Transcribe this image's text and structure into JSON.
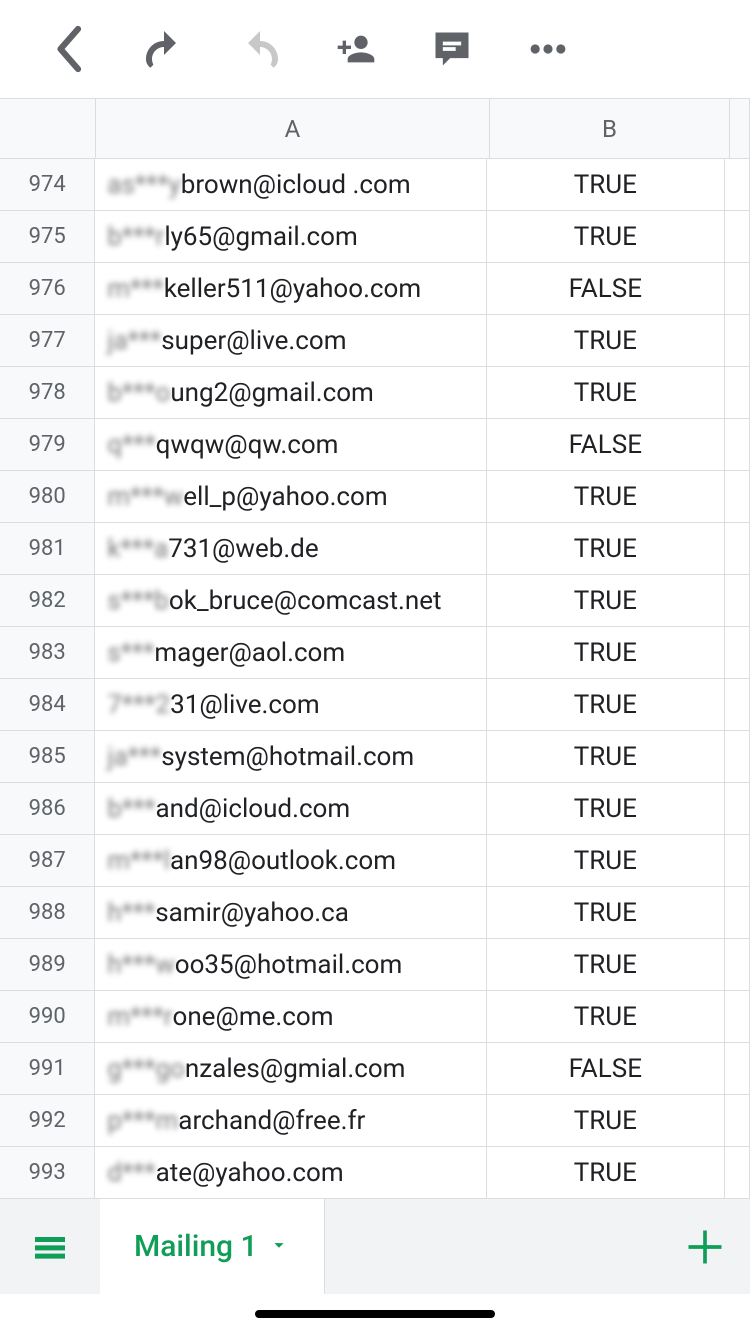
{
  "columns": [
    "A",
    "B"
  ],
  "sheet_tab": "Mailing 1",
  "rows": [
    {
      "n": 974,
      "email_prefix": "as***y",
      "email_suffix": "brown@icloud .com",
      "flag": "TRUE"
    },
    {
      "n": 975,
      "email_prefix": "b***r",
      "email_suffix": "ly65@gmail.com",
      "flag": "TRUE"
    },
    {
      "n": 976,
      "email_prefix": "m***",
      "email_suffix": "keller511@yahoo.com",
      "flag": "FALSE"
    },
    {
      "n": 977,
      "email_prefix": "ja***",
      "email_suffix": "super@live.com",
      "flag": "TRUE"
    },
    {
      "n": 978,
      "email_prefix": "b***o",
      "email_suffix": "ung2@gmail.com",
      "flag": "TRUE"
    },
    {
      "n": 979,
      "email_prefix": "q***",
      "email_suffix": "qwqw@qw.com",
      "flag": "FALSE"
    },
    {
      "n": 980,
      "email_prefix": "m***w",
      "email_suffix": "ell_p@yahoo.com",
      "flag": "TRUE"
    },
    {
      "n": 981,
      "email_prefix": "k***a",
      "email_suffix": "731@web.de",
      "flag": "TRUE"
    },
    {
      "n": 982,
      "email_prefix": "s***b",
      "email_suffix": "ok_bruce@comcast.net",
      "flag": "TRUE"
    },
    {
      "n": 983,
      "email_prefix": "s***",
      "email_suffix": "mager@aol.com",
      "flag": "TRUE"
    },
    {
      "n": 984,
      "email_prefix": "7***2",
      "email_suffix": "31@live.com",
      "flag": "TRUE"
    },
    {
      "n": 985,
      "email_prefix": "ja***",
      "email_suffix": "system@hotmail.com",
      "flag": "TRUE"
    },
    {
      "n": 986,
      "email_prefix": "b***",
      "email_suffix": "and@icloud.com",
      "flag": "TRUE"
    },
    {
      "n": 987,
      "email_prefix": "m***l",
      "email_suffix": "an98@outlook.com",
      "flag": "TRUE"
    },
    {
      "n": 988,
      "email_prefix": "h***",
      "email_suffix": "samir@yahoo.ca",
      "flag": "TRUE"
    },
    {
      "n": 989,
      "email_prefix": "h***w",
      "email_suffix": "oo35@hotmail.com",
      "flag": "TRUE"
    },
    {
      "n": 990,
      "email_prefix": "m***r",
      "email_suffix": "one@me.com",
      "flag": "TRUE"
    },
    {
      "n": 991,
      "email_prefix": "g***go",
      "email_suffix": "nzales@gmial.com",
      "flag": "FALSE"
    },
    {
      "n": 992,
      "email_prefix": "p***m",
      "email_suffix": "archand@free.fr",
      "flag": "TRUE"
    },
    {
      "n": 993,
      "email_prefix": "d***",
      "email_suffix": "ate@yahoo.com",
      "flag": "TRUE"
    }
  ]
}
